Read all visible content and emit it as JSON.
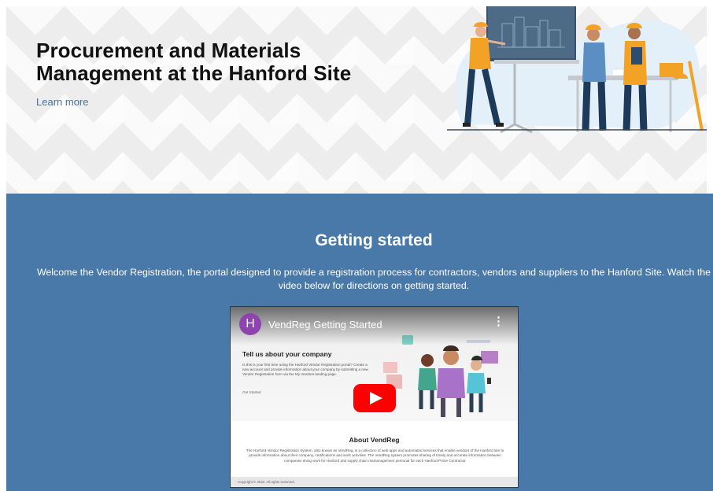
{
  "hero": {
    "title": "Procurement and Materials Management at the Hanford Site",
    "learn_more": "Learn more"
  },
  "getting_started": {
    "title": "Getting started",
    "text": "Welcome the Vendor Registration, the portal designed to provide a registration process for contractors, vendors and suppliers to the Hanford Site. Watch the video below for directions on getting started."
  },
  "video": {
    "channel_initial": "H",
    "title": "VendReg Getting Started",
    "menu_icon": "more-vert-icon",
    "play_icon": "youtube-play-icon",
    "slide": {
      "heading": "Tell us about your company",
      "body": "Is this is your first time using the Hanford Vendor Registration portal? Create a new account and provide information about your company by submitting a new Vendor Registration form via the My Vendors landing page.",
      "link": "Get Started",
      "about_title": "About VendReg",
      "about_body": "The Hanford Vendor Registration System, also known as VendReg, is a collection of web apps and automated services that enable vendors of the Hanford site to provide information about their company, certifications and work activities. The VendReg system promotes sharing of timely and accurate information between companies doing work for Hanford and supply chain mamanagement personal for each Hanford Prime Contractor",
      "copyright": "Copyright © 2022. All rights reserved."
    }
  },
  "colors": {
    "section_bg": "#4979a9",
    "link": "#4a7394",
    "youtube_red": "#ff0000",
    "avatar": "#8e44ad"
  }
}
